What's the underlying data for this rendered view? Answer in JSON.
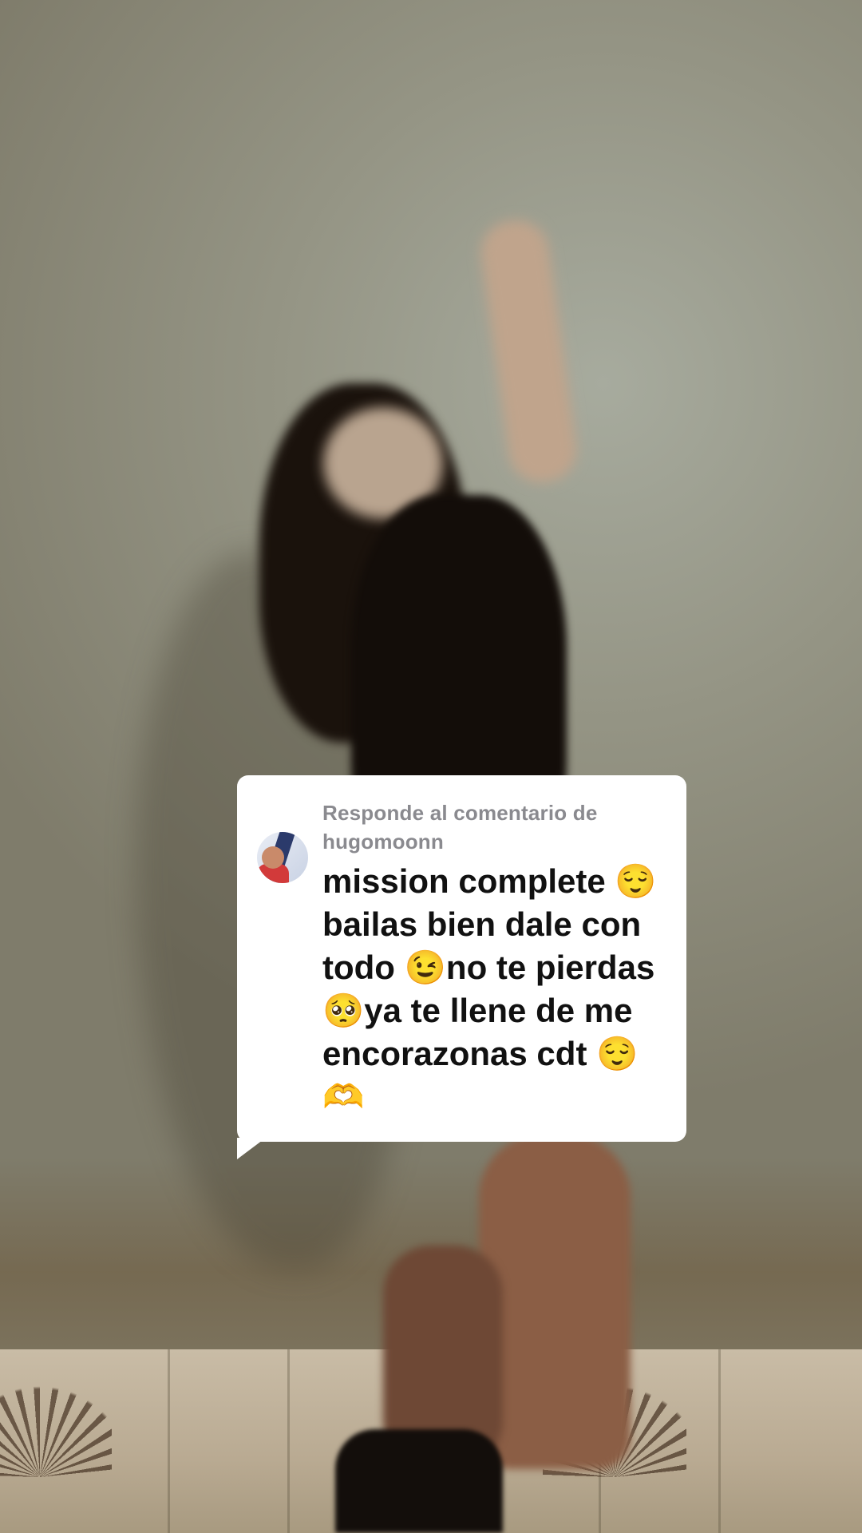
{
  "reply_sticker": {
    "header_line1": "Responde al comentario de",
    "username": "hugomoonn",
    "comment_text": "mission complete 😌\nbailas bien dale con\ntodo 😉no te pierdas\n🥺ya te llene de me\nencorazonas cdt 😌\n🫶"
  },
  "colors": {
    "card_background": "#ffffff",
    "header_text": "#8a8a8f",
    "comment_text": "#111111"
  },
  "icons": {
    "avatar": "commenter-profile-avatar"
  }
}
